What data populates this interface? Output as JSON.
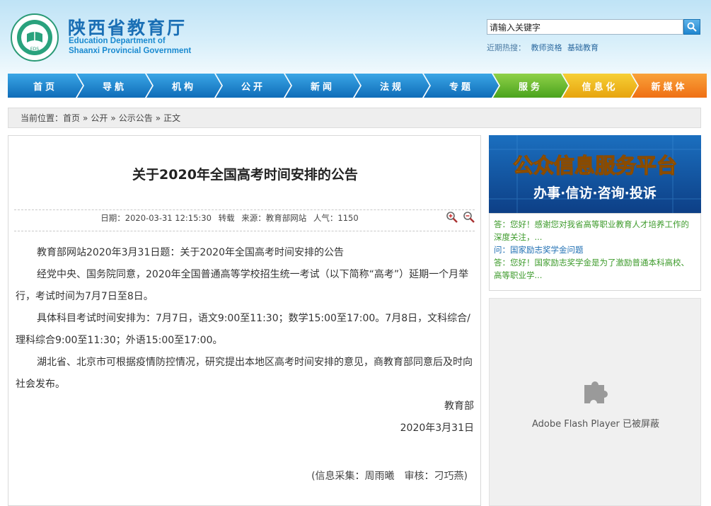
{
  "header": {
    "site_name_cn": "陕西省教育厅",
    "site_name_en_1": "Education Department of",
    "site_name_en_2": "Shaanxi Provincial Government",
    "logo_text": "EDS",
    "search_value": "请输入关键字",
    "hot_label": "近期热搜：",
    "hot_keywords": [
      "教师资格",
      "基础教育"
    ]
  },
  "nav": [
    {
      "label": "首页",
      "color": "#1a7fcc"
    },
    {
      "label": "导航",
      "color": "#1a7fcc"
    },
    {
      "label": "机构",
      "color": "#1a7fcc"
    },
    {
      "label": "公开",
      "color": "#1a7fcc"
    },
    {
      "label": "新闻",
      "color": "#1a7fcc"
    },
    {
      "label": "法规",
      "color": "#1a7fcc"
    },
    {
      "label": "专题",
      "color": "#1a7fcc"
    },
    {
      "label": "服务",
      "color": "#5cb52a"
    },
    {
      "label": "信息化",
      "color": "#eab31c"
    },
    {
      "label": "新媒体",
      "color": "#f2821f"
    }
  ],
  "breadcrumb": {
    "prefix": "当前位置：",
    "items": [
      "首页",
      "公开",
      "公示公告",
      "正文"
    ],
    "separator": "»"
  },
  "article": {
    "title": "关于2020年全国高考时间安排的公告",
    "date": "日期：2020-03-31 12:15:30",
    "repost": "转载",
    "source": "来源：教育部网站",
    "views": "人气：1150",
    "paragraphs": [
      "教育部网站2020年3月31日题：关于2020年全国高考时间安排的公告",
      "经党中央、国务院同意，2020年全国普通高等学校招生统一考试（以下简称“高考”）延期一个月举行，考试时间为7月7日至8日。",
      "具体科目考试时间安排为：7月7日，语文9:00至11:30；数学15:00至17:00。7月8日，文科综合/理科综合9:00至11:30；外语15:00至17:00。",
      "湖北省、北京市可根据疫情防控情况，研究提出本地区高考时间安排的意见，商教育部同意后及时向社会发布。"
    ],
    "signature": "教育部",
    "sign_date": "2020年3月31日",
    "credit": "(信息采集：周雨曦　审核：刁巧燕)"
  },
  "sidebar": {
    "banner_title": "公众信息服务平台",
    "banner_sub": "办事·信访·咨询·投诉",
    "qa": [
      {
        "prefix": "答：",
        "text": "您好！感谢您对我省高等职业教育人才培养工作的深度关注，..."
      },
      {
        "prefix": "问：",
        "text": "国家励志奖学金问题"
      },
      {
        "prefix": "答：",
        "text": "您好！国家励志奖学金是为了激励普通本科高校、高等职业学..."
      }
    ],
    "flash_text": "Adobe Flash Player 已被屏蔽"
  }
}
